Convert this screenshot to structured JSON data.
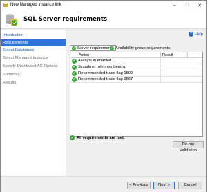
{
  "window": {
    "title": "New Managed Instance link",
    "icons": {
      "app": "sql-server-icon",
      "minimize": "minimize-icon",
      "maximize": "maximize-icon",
      "close": "close-icon"
    }
  },
  "header": {
    "title": "SQL Server requirements",
    "icon": "requirements-check-icon"
  },
  "sidebar": {
    "items": [
      {
        "label": "Introduction",
        "state": "link"
      },
      {
        "label": "Requirements",
        "state": "active"
      },
      {
        "label": "Select Databases",
        "state": "link"
      },
      {
        "label": "Select Managed Instance",
        "state": "inactive"
      },
      {
        "label": "Specify Distributed AG Options",
        "state": "inactive"
      },
      {
        "label": "Summary",
        "state": "inactive"
      },
      {
        "label": "Results",
        "state": "inactive"
      }
    ]
  },
  "help": {
    "label": "Help",
    "icon": "help-icon"
  },
  "tabs": [
    {
      "label": "Server requirements",
      "icon": "success-check-icon",
      "selected": true
    },
    {
      "label": "Availability group requirements",
      "icon": "success-check-icon",
      "selected": false
    }
  ],
  "grid": {
    "columns": [
      "Action",
      "Result"
    ],
    "rows": [
      {
        "action": "AlwaysOn enabled",
        "result": "",
        "icon": "success-check-icon"
      },
      {
        "action": "Sysadmin role membership",
        "result": "",
        "icon": "success-check-icon"
      },
      {
        "action": "Recommended trace flag 1800",
        "result": "",
        "icon": "success-check-icon"
      },
      {
        "action": "Recommended trace flag 9567",
        "result": "",
        "icon": "success-check-icon"
      }
    ]
  },
  "summary": {
    "text": "All requirements are met.",
    "icon": "success-check-icon"
  },
  "buttons": {
    "rerun": "Re-run Validation",
    "previous": "< Previous",
    "next": "Next >",
    "cancel": "Cancel"
  },
  "colors": {
    "accent": "#3072d8",
    "link": "#1f5fbf",
    "success": "#3aa53a"
  }
}
